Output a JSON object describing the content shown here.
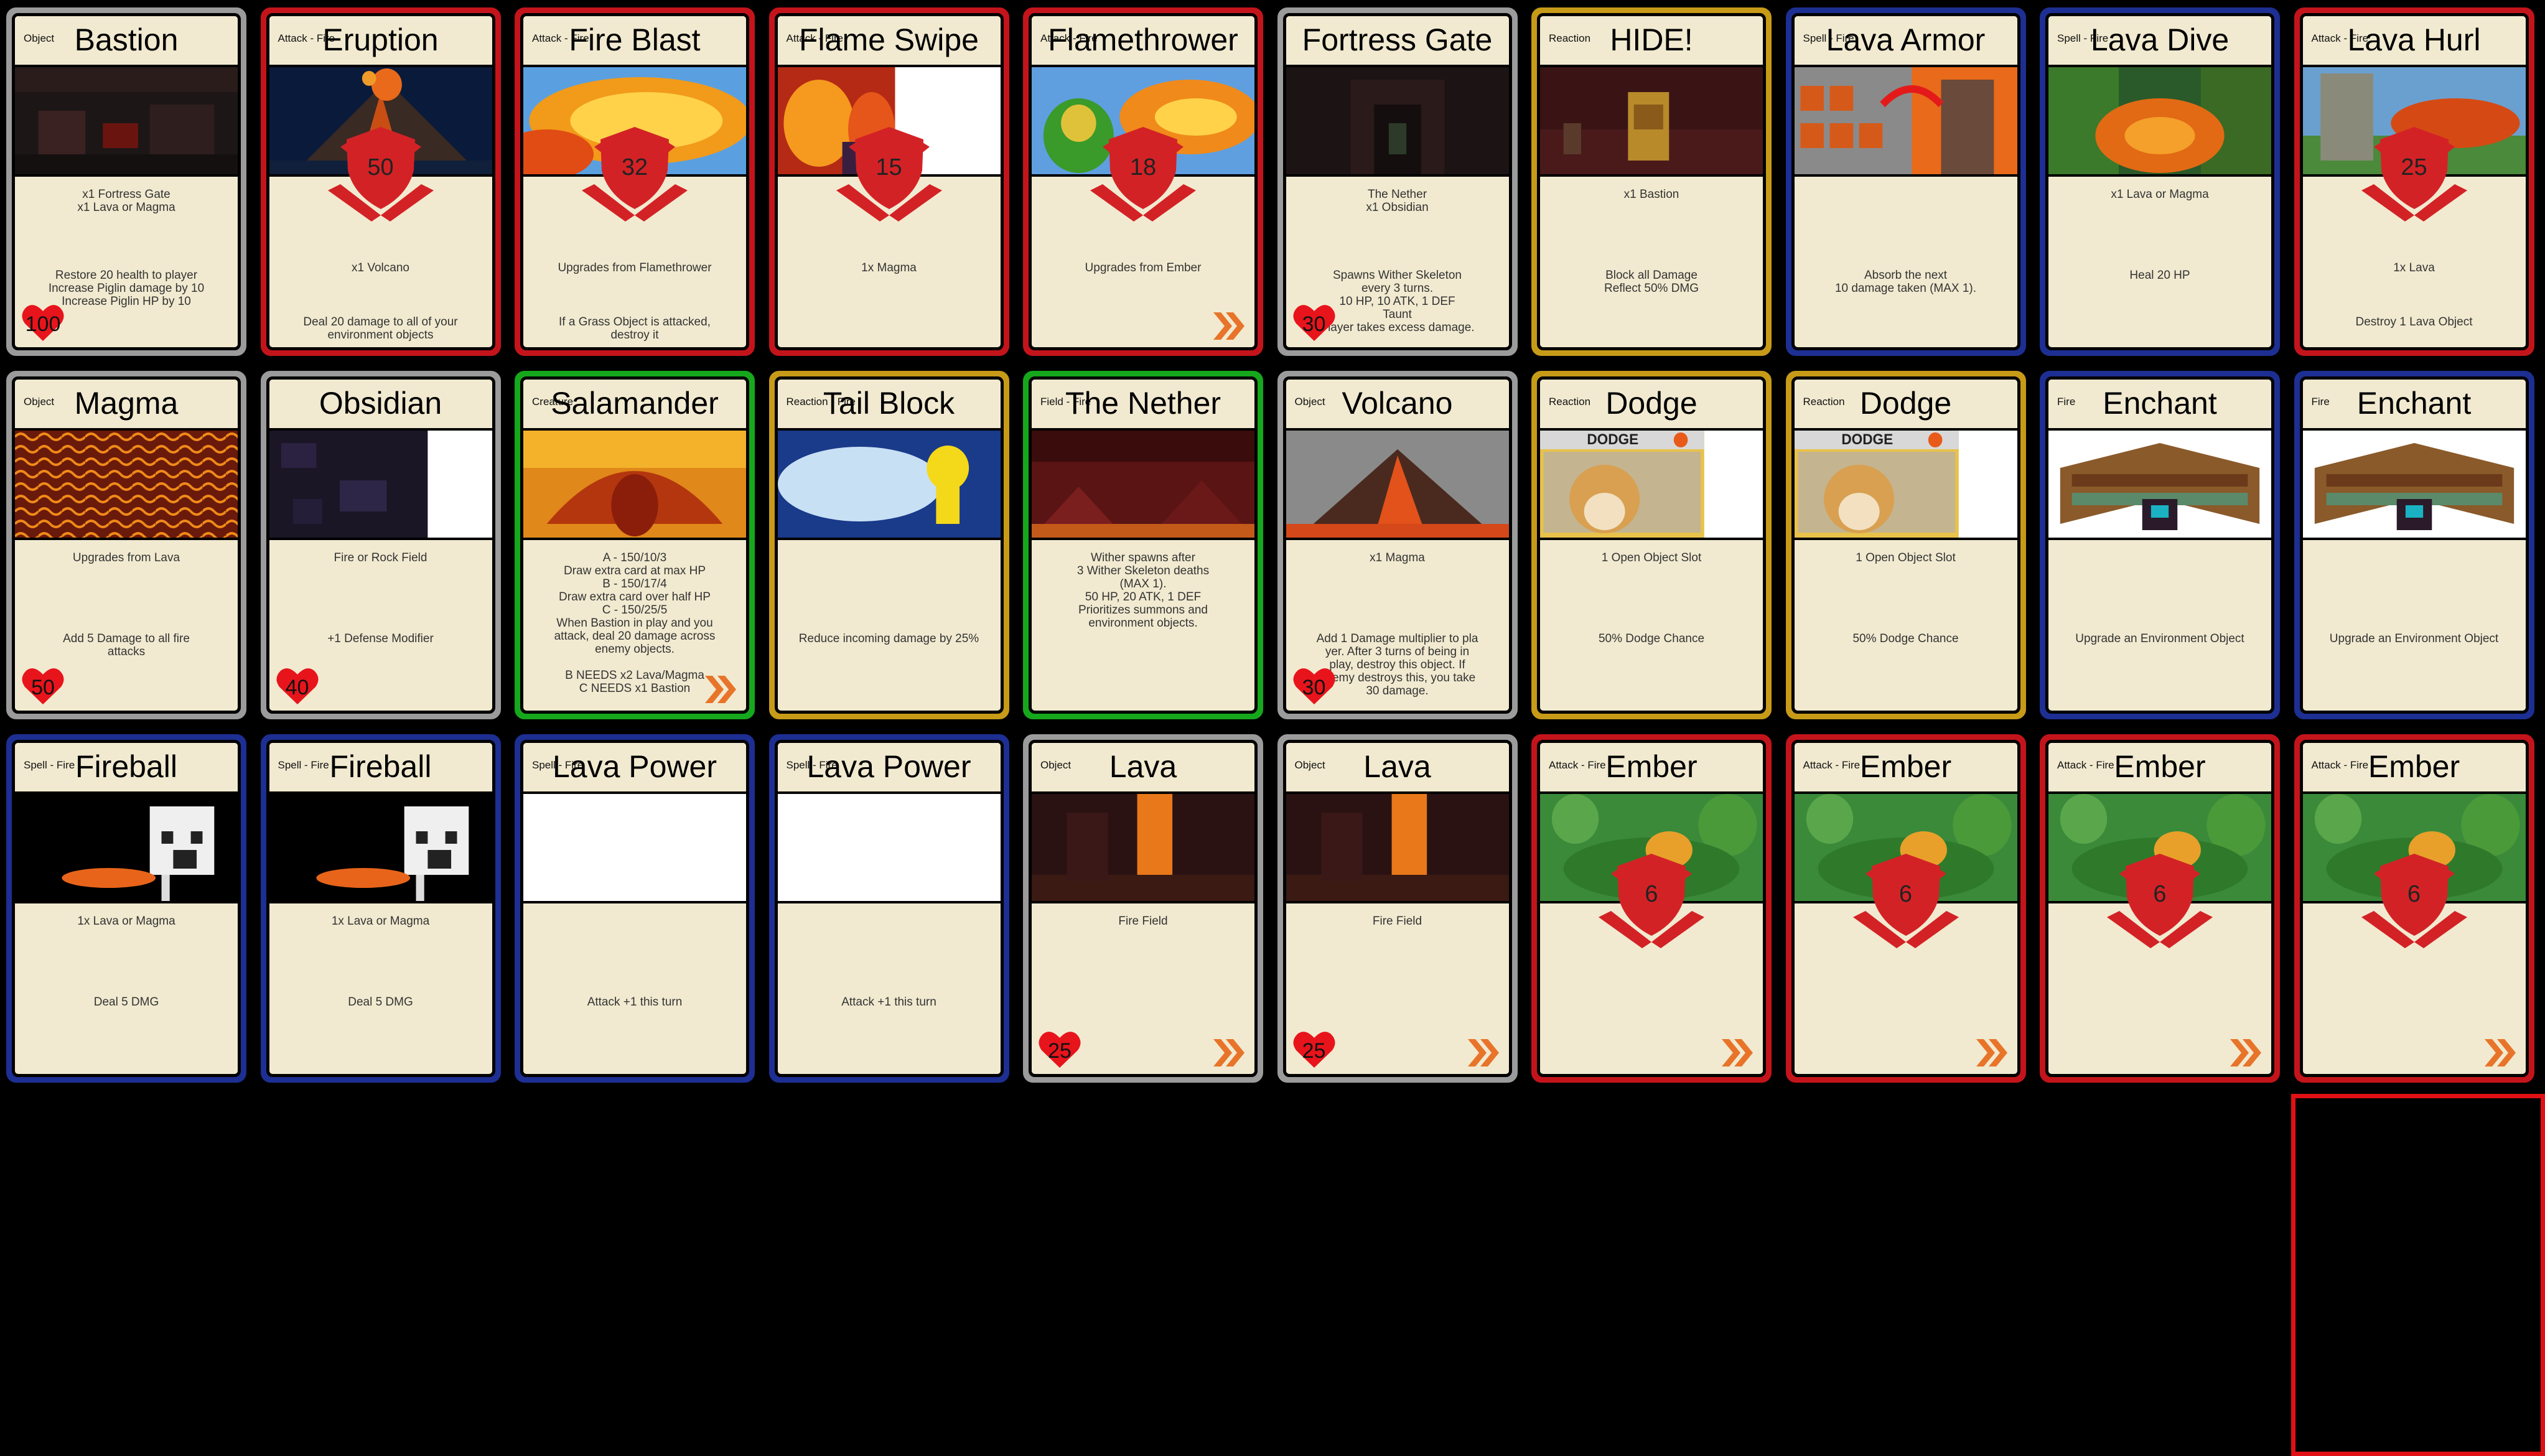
{
  "colors": {
    "gray": "#9b9b9b",
    "red": "#c4141b",
    "blue": "#1d2f92",
    "yellow": "#c79a18",
    "green": "#16a81c",
    "card_face": "#f1ead0",
    "shield": "#d32226",
    "heart": "#e8141c",
    "chevron": "#e8742a"
  },
  "cards": [
    {
      "name": "Bastion",
      "type": "Object",
      "frame": "gray",
      "art": "dark-fortress-interior",
      "req": "x1 Fortress Gate\nx1 Lava or Magma",
      "effect": "Restore 20 health to player\nIncrease Piglin damage by 10\nIncrease Piglin HP by 10",
      "hp": "100"
    },
    {
      "name": "Eruption",
      "type": "Attack - Fire",
      "frame": "red",
      "art": "volcano-eruption-night",
      "damage": "50",
      "req": "x1 Volcano",
      "effect": "Deal 20 damage to all of your\nenvironment objects"
    },
    {
      "name": "Fire Blast",
      "type": "Attack - Fire",
      "frame": "red",
      "art": "fire-blast-explosion",
      "damage": "32",
      "req": "Upgrades from Flamethrower",
      "effect": "If a Grass Object is attacked,\ndestroy it"
    },
    {
      "name": "Flame Swipe",
      "type": "Attack - Fire",
      "frame": "red",
      "art": "flame-swipe-partial",
      "damage": "15",
      "req": "1x Magma",
      "effect": ""
    },
    {
      "name": "Flamethrower",
      "type": "Attack - Fire",
      "frame": "red",
      "art": "flamethrower-blast",
      "damage": "18",
      "req": "Upgrades from Ember",
      "effect": "",
      "chevron": true
    },
    {
      "name": "Fortress Gate",
      "type": "",
      "frame": "gray",
      "art": "nether-fortress-corridor",
      "req": "The Nether\nx1 Obsidian",
      "effect": "Spawns Wither Skeleton\nevery 3 turns.\n10 HP, 10 ATK, 1 DEF\nTaunt\nPlayer takes excess damage.",
      "hp": "30"
    },
    {
      "name": "HIDE!",
      "type": "Reaction",
      "frame": "yellow",
      "art": "piglin-hiding",
      "req": "x1 Bastion",
      "effect": "Block all Damage\nReflect 50% DMG"
    },
    {
      "name": "Lava Armor",
      "type": "Spell - Fire",
      "frame": "blue",
      "art": "lava-armor-crafting",
      "req": "",
      "effect": "Absorb the next\n10 damage taken (MAX 1)."
    },
    {
      "name": "Lava Dive",
      "type": "Spell - Fire",
      "frame": "blue",
      "art": "lava-dive-forest",
      "req": "x1 Lava or Magma",
      "effect": "Heal 20 HP"
    },
    {
      "name": "Lava Hurl",
      "type": "Attack - Fire",
      "frame": "red",
      "art": "lava-hurl-golem",
      "damage": "25",
      "req": "1x Lava",
      "effect": "Destroy 1 Lava Object"
    },
    {
      "name": "Magma",
      "type": "Object",
      "frame": "gray",
      "art": "magma-block-texture",
      "req": "Upgrades from Lava",
      "effect": "Add 5 Damage to all fire\nattacks",
      "hp": "50"
    },
    {
      "name": "Obsidian",
      "type": "",
      "frame": "gray",
      "art": "obsidian-block-texture",
      "req": "Fire or Rock Field",
      "effect": "+1 Defense Modifier",
      "hp": "40"
    },
    {
      "name": "Salamander",
      "type": "Creature",
      "frame": "green",
      "art": "fire-dragon",
      "req": "A - 150/10/3\nDraw extra card at max HP\nB - 150/17/4\nDraw extra card over half HP\nC - 150/25/5\nWhen Bastion in play and you\nattack, deal 20 damage across\nenemy objects.\n\nB NEEDS x2 Lava/Magma\nC NEEDS x1 Bastion",
      "effect": "",
      "chevron": true
    },
    {
      "name": "Tail Block",
      "type": "Reaction - Fire",
      "frame": "yellow",
      "art": "electric-tail-block",
      "req": "",
      "effect": "Reduce incoming damage by 25%"
    },
    {
      "name": "The Nether",
      "type": "Field - Fire",
      "frame": "green",
      "art": "nether-landscape",
      "req": "Wither spawns after\n3 Wither Skeleton deaths\n(MAX 1).\n50 HP, 20 ATK, 1 DEF\nPrioritizes summons and\nenvironment objects.",
      "effect": ""
    },
    {
      "name": "Volcano",
      "type": "Object",
      "frame": "gray",
      "art": "volcano-erupting-day",
      "req": "x1 Magma",
      "effect": "Add 1 Damage multiplier to pla\nyer. After 3 turns of being in\nplay, destroy this object. If\nenemy destroys this, you take\n30 damage.",
      "hp": "30"
    },
    {
      "name": "Dodge",
      "type": "Reaction",
      "frame": "yellow",
      "art": "doge-card",
      "req": "1 Open Object Slot",
      "effect": "50% Dodge Chance"
    },
    {
      "name": "Dodge",
      "type": "Reaction",
      "frame": "yellow",
      "art": "doge-card",
      "req": "1 Open Object Slot",
      "effect": "50% Dodge Chance"
    },
    {
      "name": "Enchant",
      "type": "Fire",
      "frame": "blue",
      "art": "enchanting-table-bookshelves",
      "req": "",
      "effect": "Upgrade an Environment Object"
    },
    {
      "name": "Enchant",
      "type": "Fire",
      "frame": "blue",
      "art": "enchanting-table-bookshelves",
      "req": "",
      "effect": "Upgrade an Environment Object"
    },
    {
      "name": "Fireball",
      "type": "Spell - Fire",
      "frame": "blue",
      "art": "ghast-fireball",
      "req": "1x Lava or Magma",
      "effect": "Deal 5 DMG"
    },
    {
      "name": "Fireball",
      "type": "Spell - Fire",
      "frame": "blue",
      "art": "ghast-fireball",
      "req": "1x Lava or Magma",
      "effect": "Deal 5 DMG"
    },
    {
      "name": "Lava Power",
      "type": "Spell - Fire",
      "frame": "blue",
      "art": "blank",
      "req": "",
      "effect": "Attack +1 this turn"
    },
    {
      "name": "Lava Power",
      "type": "Spell - Fire",
      "frame": "blue",
      "art": "blank",
      "req": "",
      "effect": "Attack +1 this turn"
    },
    {
      "name": "Lava",
      "type": "Object",
      "frame": "gray",
      "art": "lava-fall-nether",
      "req": "Fire Field",
      "effect": "",
      "hp": "25",
      "chevron": true
    },
    {
      "name": "Lava",
      "type": "Object",
      "frame": "gray",
      "art": "lava-fall-nether",
      "req": "Fire Field",
      "effect": "",
      "hp": "25",
      "chevron": true
    },
    {
      "name": "Ember",
      "type": "Attack - Fire",
      "frame": "red",
      "art": "ember-leaves",
      "damage": "6",
      "req": "",
      "effect": "",
      "chevron": true
    },
    {
      "name": "Ember",
      "type": "Attack - Fire",
      "frame": "red",
      "art": "ember-leaves",
      "damage": "6",
      "req": "",
      "effect": "",
      "chevron": true
    },
    {
      "name": "Ember",
      "type": "Attack - Fire",
      "frame": "red",
      "art": "ember-leaves",
      "damage": "6",
      "req": "",
      "effect": "",
      "chevron": true
    },
    {
      "name": "Ember",
      "type": "Attack - Fire",
      "frame": "red",
      "art": "ember-leaves",
      "damage": "6",
      "req": "",
      "effect": "",
      "chevron": true
    }
  ]
}
